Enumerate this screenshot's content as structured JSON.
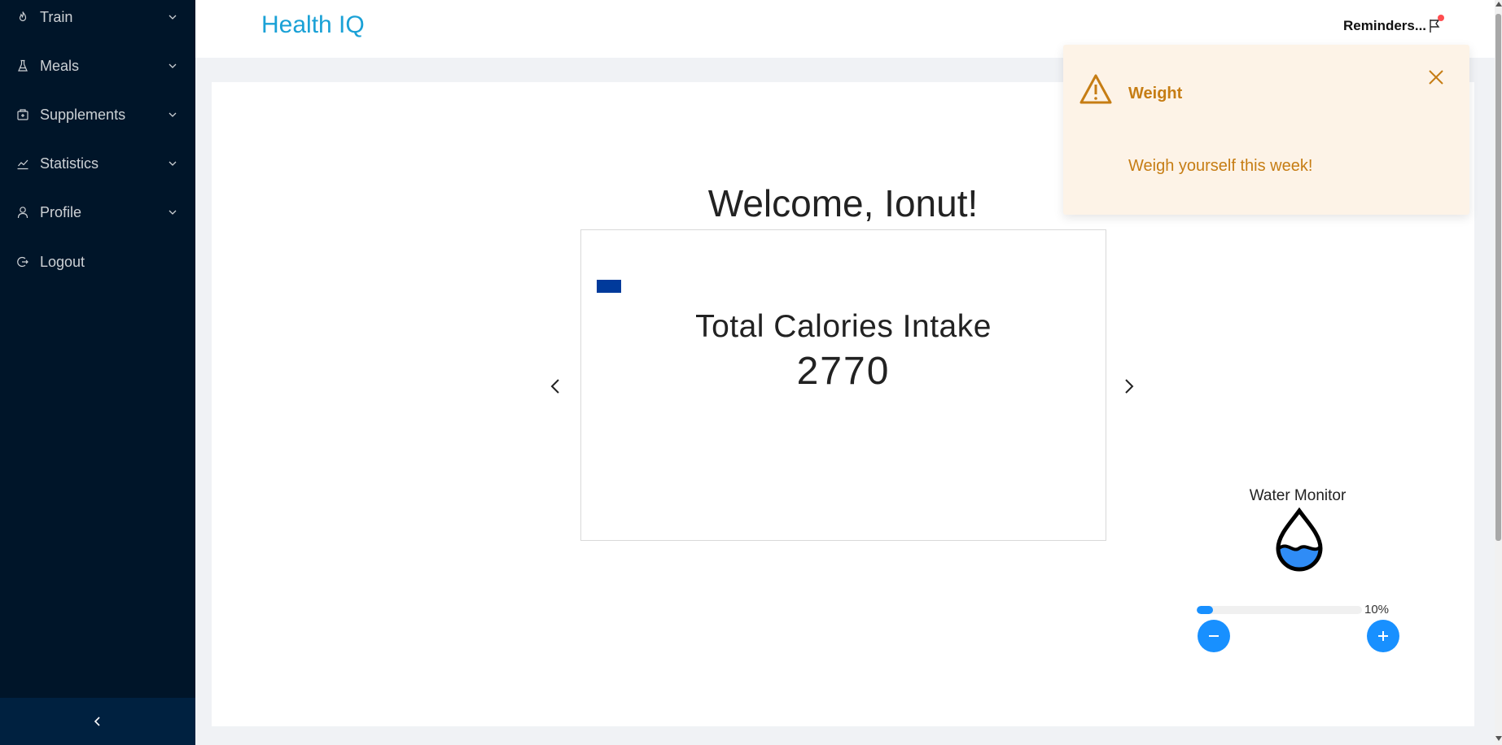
{
  "sidebar": {
    "items": [
      {
        "label": "Train",
        "icon": "flame-icon"
      },
      {
        "label": "Meals",
        "icon": "flask-icon"
      },
      {
        "label": "Supplements",
        "icon": "medicine-box-icon"
      },
      {
        "label": "Statistics",
        "icon": "line-chart-icon"
      },
      {
        "label": "Profile",
        "icon": "user-icon"
      },
      {
        "label": "Logout",
        "icon": "logout-icon"
      }
    ],
    "collapse_icon": "chevron-left-icon",
    "background_color": "#001529"
  },
  "header": {
    "logo": "Health IQ",
    "reminders_label": "Reminders...",
    "logo_color": "#1aa1d6"
  },
  "main": {
    "welcome": "Welcome, Ionut!",
    "carousel": {
      "title": "Total Calories Intake",
      "value": "2770"
    },
    "water": {
      "title": "Water Monitor",
      "percent_label": "10%",
      "percent": 10,
      "accent_color": "#1890ff"
    }
  },
  "notification": {
    "title": "Weight",
    "message": "Weigh yourself this week!",
    "icon": "warning-icon",
    "color": "#c67d14",
    "background": "#fdf3e7"
  }
}
